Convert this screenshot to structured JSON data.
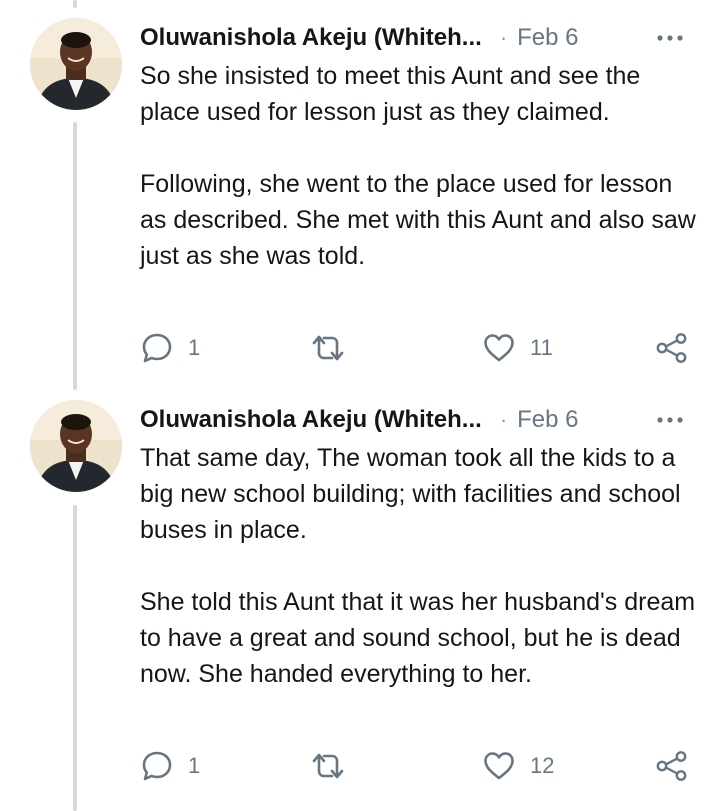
{
  "tweets": [
    {
      "author": "Oluwanishola Akeju (Whiteh...",
      "separator": "·",
      "date": "Feb 6",
      "paragraphs": [
        "So she insisted to meet this Aunt and see the place used for lesson just as they claimed.",
        "Following, she went to the place used for lesson as described. She met with this Aunt and also saw just as she was told."
      ],
      "reply_count": "1",
      "like_count": "11"
    },
    {
      "author": "Oluwanishola Akeju (Whiteh...",
      "separator": "·",
      "date": "Feb 6",
      "paragraphs": [
        "That same day, The woman took all the kids to a big new school building; with facilities and school buses in place.",
        "She told this Aunt that it was her husband's dream to have a great and sound school, but he is dead now. She handed everything to her."
      ],
      "reply_count": "1",
      "like_count": "12"
    }
  ],
  "icons": {
    "more": "more-horizontal-icon",
    "reply": "reply-bubble-icon",
    "retweet": "retweet-icon",
    "like": "heart-icon",
    "share": "share-icon"
  },
  "colors": {
    "text": "#14171a",
    "muted": "#657786",
    "icon": "#66757f",
    "thread_line": "#d4d9dd"
  }
}
